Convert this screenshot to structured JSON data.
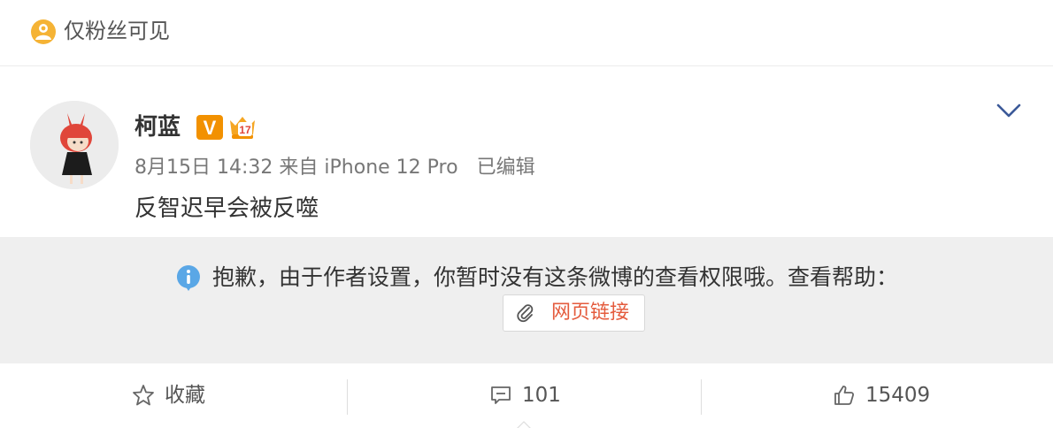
{
  "header": {
    "visibility_label": "仅粉丝可见",
    "visibility_icon": "fans-visibility-icon"
  },
  "post": {
    "author": "柯蓝",
    "badges": [
      {
        "icon": "verified-v-icon",
        "text": "V"
      },
      {
        "icon": "vip-crown-icon",
        "text": "17"
      }
    ],
    "date": "8月15日",
    "time": "14:32",
    "source_prefix": "来自",
    "source": "iPhone 12 Pro",
    "edited_label": "已编辑",
    "text": "反智迟早会被反噬",
    "menu_icon": "chevron-down-icon"
  },
  "notice": {
    "message": "抱歉，由于作者设置，你暂时没有这条微博的查看权限哦。查看帮助：",
    "link_label": "网页链接",
    "link_icon": "paperclip-icon"
  },
  "actions": {
    "favorite_label": "收藏",
    "comment_count": "101",
    "like_count": "15409"
  },
  "colors": {
    "link": "#e45b3d",
    "verified": "#f29100",
    "notice_bg": "#efefef",
    "info_icon": "#5aa7e6"
  }
}
